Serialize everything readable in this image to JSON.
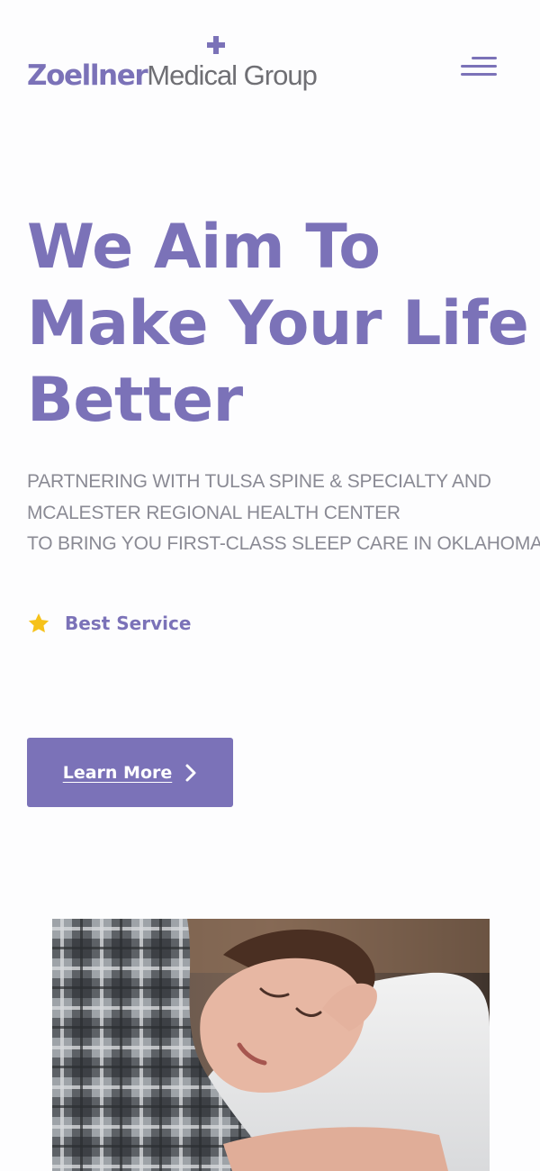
{
  "brand": {
    "name_bold": "Zoellner",
    "name_light": "Medical Group",
    "accent_color": "#7b72b8",
    "logo_icon": "plus-cross-icon"
  },
  "header": {
    "menu_icon": "hamburger-menu-icon"
  },
  "hero": {
    "title_lines": [
      "We Aim To",
      "Make Your Life",
      "Better"
    ],
    "subtitle_lines": [
      "PARTNERING WITH TULSA SPINE & SPECIALTY AND",
      "MCALESTER REGIONAL HEALTH CENTER",
      "TO BRING YOU FIRST-CLASS SLEEP CARE IN OKLAHOMA"
    ],
    "badge": {
      "icon": "star-icon",
      "icon_color": "#f6c21a",
      "label": "Best Service"
    },
    "cta": {
      "label": "Learn More",
      "icon": "chevron-right-icon"
    }
  },
  "media": {
    "image_subject": "woman-sleeping-on-pillow"
  }
}
